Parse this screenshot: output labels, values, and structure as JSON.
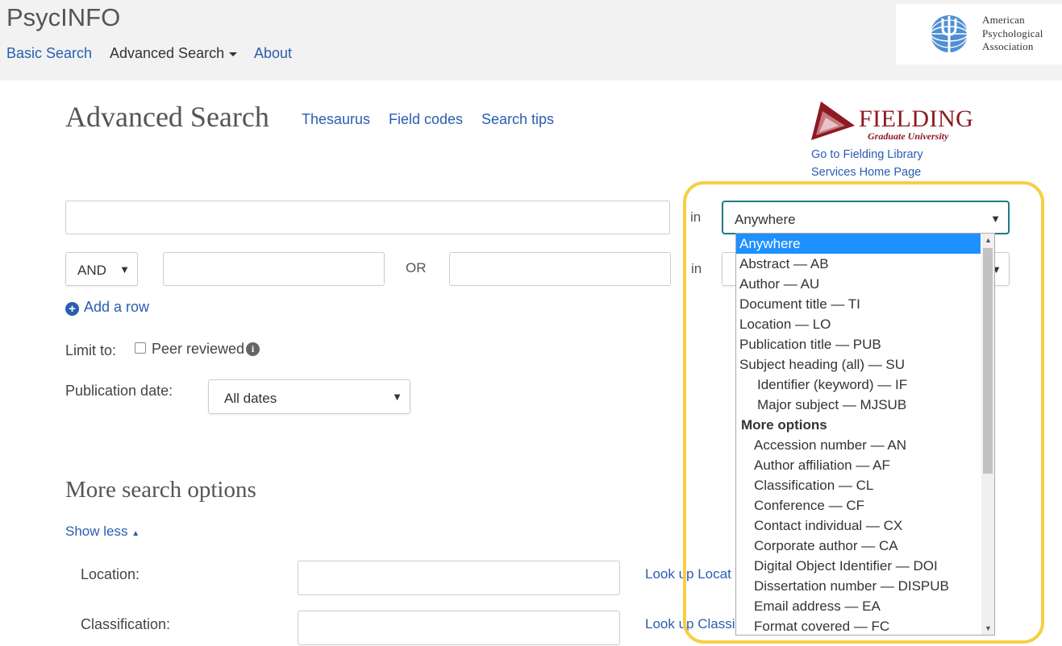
{
  "header": {
    "app_title": "PsycINFO",
    "nav": {
      "basic_search": "Basic Search",
      "advanced_search": "Advanced Search",
      "about": "About"
    },
    "apa_logo": {
      "line1": "American",
      "line2": "Psychological",
      "line3": "Association"
    }
  },
  "main": {
    "title": "Advanced Search",
    "links": {
      "thesaurus": "Thesaurus",
      "field_codes": "Field codes",
      "search_tips": "Search tips"
    },
    "institution": {
      "name": "FIELDING",
      "subtitle": "Graduate University",
      "library_link": "Go to Fielding Library Services Home Page"
    }
  },
  "search": {
    "row1": {
      "in_label": "in",
      "field_selected": "Anywhere"
    },
    "row2": {
      "operator": "AND",
      "or_label": "OR",
      "in_label": "in"
    },
    "add_row": "Add a row",
    "limit_label": "Limit to:",
    "peer_reviewed": "Peer reviewed",
    "pub_date_label": "Publication date:",
    "pub_date_value": "All dates"
  },
  "dropdown": {
    "options": [
      {
        "label": "Anywhere",
        "level": 0,
        "selected": true
      },
      {
        "label": "Abstract — AB",
        "level": 0
      },
      {
        "label": "Author — AU",
        "level": 0
      },
      {
        "label": "Document title — TI",
        "level": 0
      },
      {
        "label": "Location — LO",
        "level": 0
      },
      {
        "label": "Publication title — PUB",
        "level": 0
      },
      {
        "label": "Subject heading (all) — SU",
        "level": 0
      },
      {
        "label": "Identifier (keyword) — IF",
        "level": 1
      },
      {
        "label": "Major subject — MJSUB",
        "level": 1
      },
      {
        "label": "More options",
        "level": "group"
      },
      {
        "label": "Accession number — AN",
        "level": 2
      },
      {
        "label": "Author affiliation — AF",
        "level": 2
      },
      {
        "label": "Classification — CL",
        "level": 2
      },
      {
        "label": "Conference — CF",
        "level": 2
      },
      {
        "label": "Contact individual — CX",
        "level": 2
      },
      {
        "label": "Corporate author — CA",
        "level": 2
      },
      {
        "label": "Digital Object Identifier — DOI",
        "level": 2
      },
      {
        "label": "Dissertation number — DISPUB",
        "level": 2
      },
      {
        "label": "Email address — EA",
        "level": 2
      },
      {
        "label": "Format covered — FC",
        "level": 2
      }
    ]
  },
  "more_options": {
    "title": "More search options",
    "show_less": "Show less",
    "location_label": "Location:",
    "location_lookup": "Look up Locat",
    "classification_label": "Classification:",
    "classification_lookup": "Look up Classi"
  },
  "colors": {
    "link": "#2a5db0",
    "selected_option": "#1e90ff",
    "highlight": "#f7ce45",
    "fielding_red": "#8d1a22",
    "focus_border": "#1f7c87"
  }
}
